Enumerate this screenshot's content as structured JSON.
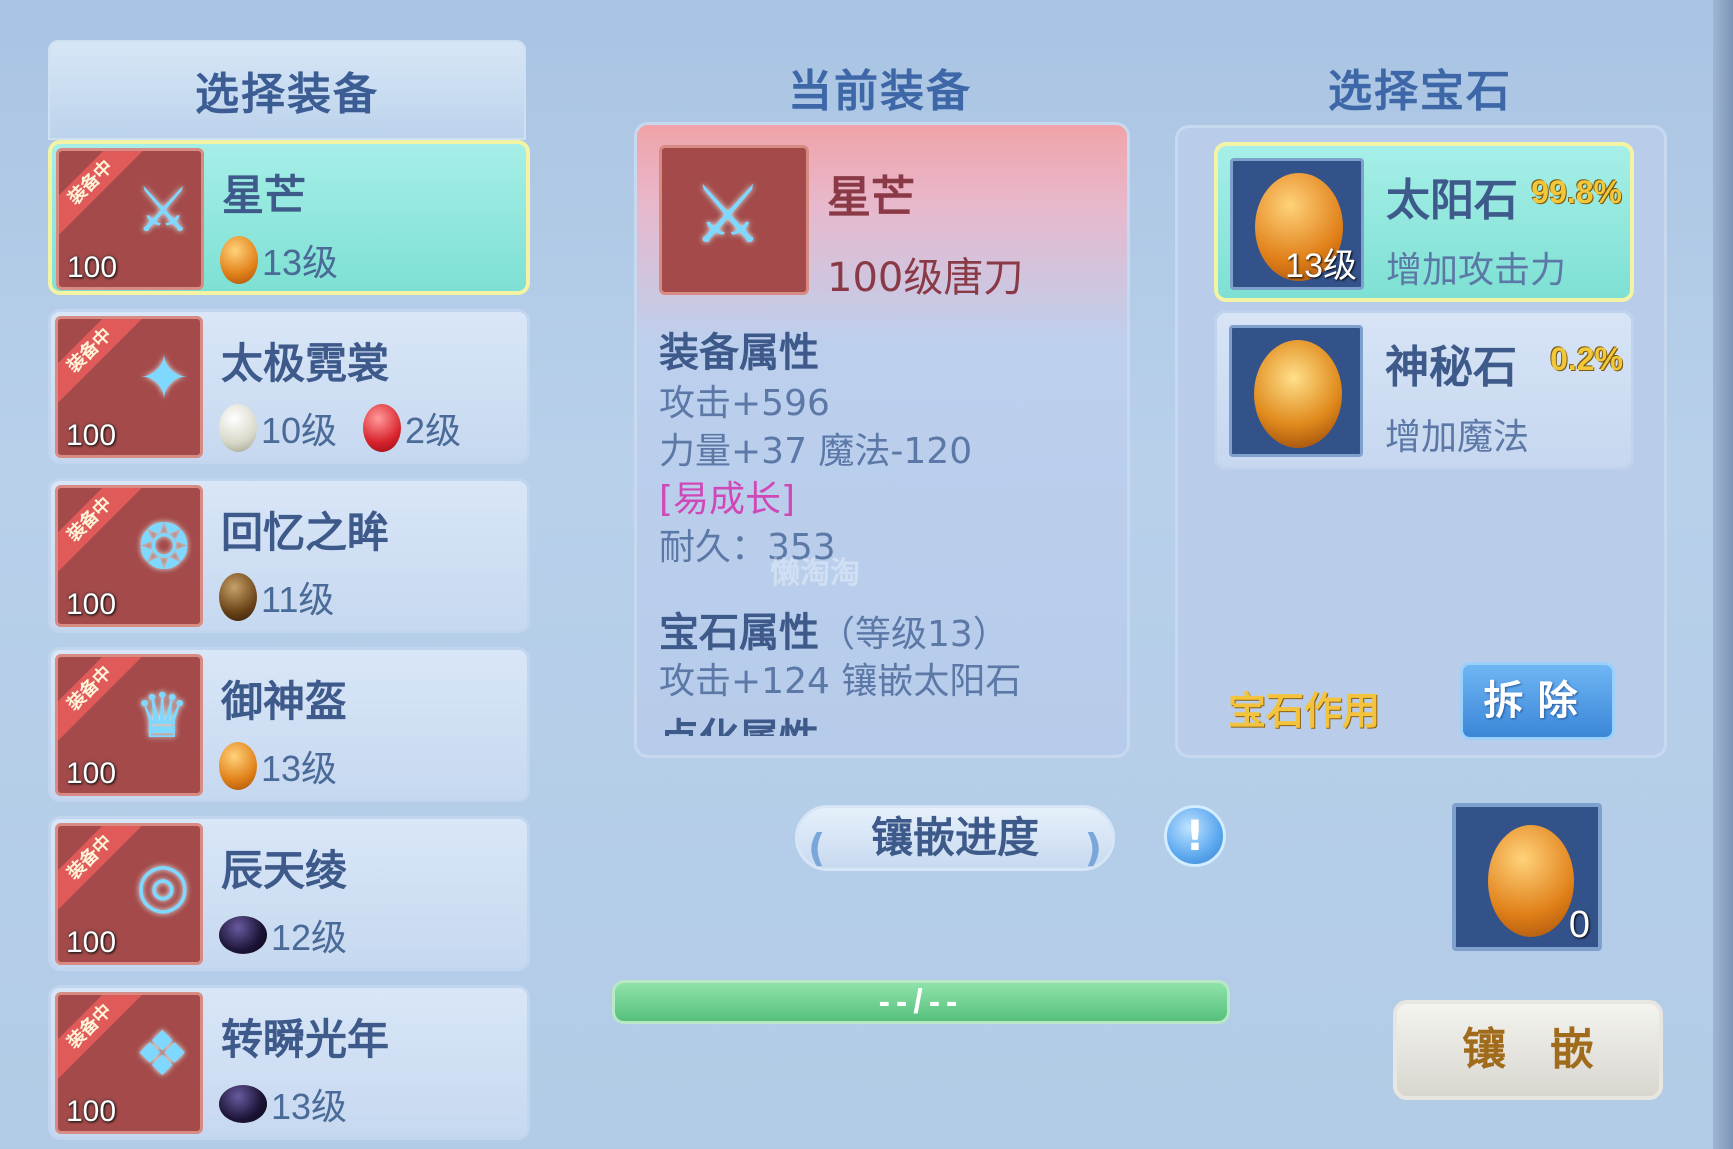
{
  "left_panel": {
    "title": "选择装备",
    "items": [
      {
        "ribbon": "装备中",
        "level": "100",
        "name": "星芒",
        "gems": [
          {
            "color": "orange",
            "level": "13级"
          }
        ],
        "selected": true
      },
      {
        "ribbon": "装备中",
        "level": "100",
        "name": "太极霓裳",
        "gems": [
          {
            "color": "white",
            "level": "10级"
          },
          {
            "color": "red",
            "level": "2级"
          }
        ],
        "selected": false
      },
      {
        "ribbon": "装备中",
        "level": "100",
        "name": "回忆之眸",
        "gems": [
          {
            "color": "brown",
            "level": "11级"
          }
        ],
        "selected": false
      },
      {
        "ribbon": "装备中",
        "level": "100",
        "name": "御神盔",
        "gems": [
          {
            "color": "orange",
            "level": "13级"
          }
        ],
        "selected": false
      },
      {
        "ribbon": "装备中",
        "level": "100",
        "name": "辰天绫",
        "gems": [
          {
            "color": "dark",
            "level": "12级"
          }
        ],
        "selected": false
      },
      {
        "ribbon": "装备中",
        "level": "100",
        "name": "转瞬光年",
        "gems": [
          {
            "color": "dark",
            "level": "13级"
          }
        ],
        "selected": false
      }
    ]
  },
  "current_equipment": {
    "title": "当前装备",
    "name": "星芒",
    "subtitle": "100级唐刀",
    "attributes_heading": "装备属性",
    "attributes": [
      "攻击+596",
      "力量+37 魔法-120"
    ],
    "tag": "[易成长]",
    "durability": "耐久：353",
    "gem_attributes_heading": "宝石属性",
    "gem_level_note": "（等级13）",
    "gem_attributes": [
      "攻击+124 镶嵌太阳石"
    ],
    "partial_heading": "点化属性"
  },
  "watermark": "懒淘淘",
  "gem_panel": {
    "title": "选择宝石",
    "stones": [
      {
        "name": "太阳石",
        "rate": "99.8%",
        "level": "13级",
        "desc": "增加攻击力",
        "selected": true
      },
      {
        "name": "神秘石",
        "rate": "0.2%",
        "level": "",
        "desc": "增加魔法",
        "selected": false
      }
    ],
    "effect_link": "宝石作用",
    "remove_button": "拆除"
  },
  "inlay": {
    "progress_label": "镶嵌进度",
    "info_icon": "!",
    "progress_text": "--/--",
    "gem_count": "0",
    "inlay_button": "镶嵌"
  }
}
